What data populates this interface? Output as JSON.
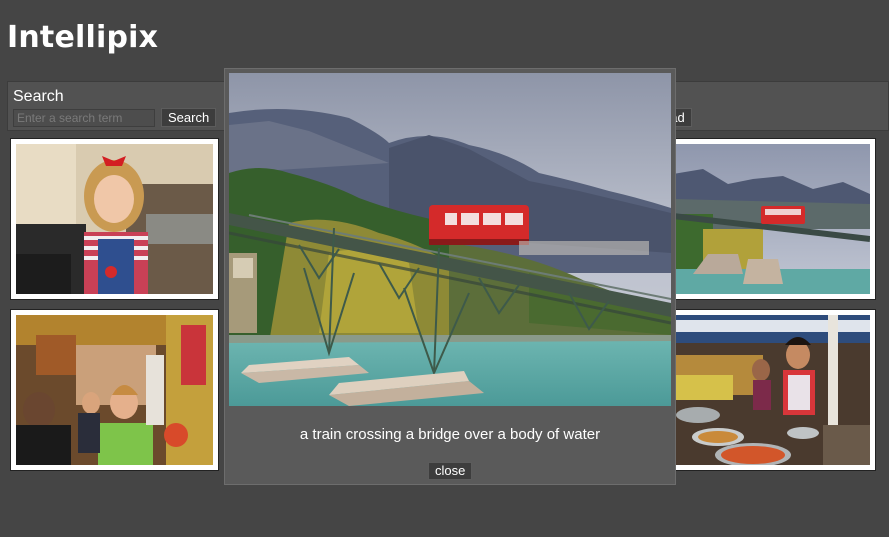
{
  "app": {
    "title": "Intellipix"
  },
  "search": {
    "label": "Search",
    "placeholder": "Enter a search term",
    "button_label": "Search",
    "upload_label": "oad"
  },
  "gallery": {
    "images": [
      {
        "subject": "girl-in-kitchen"
      },
      {
        "subject": "crowded-market-street"
      },
      {
        "subject": "train-on-bridge"
      },
      {
        "subject": "food-market-stall"
      }
    ]
  },
  "modal": {
    "caption": "a train crossing a bridge over a body of water",
    "close_label": "close"
  },
  "colors": {
    "background": "#454545",
    "panel": "#525252",
    "modal": "#5a5a5a",
    "train": "#d42a2a"
  }
}
